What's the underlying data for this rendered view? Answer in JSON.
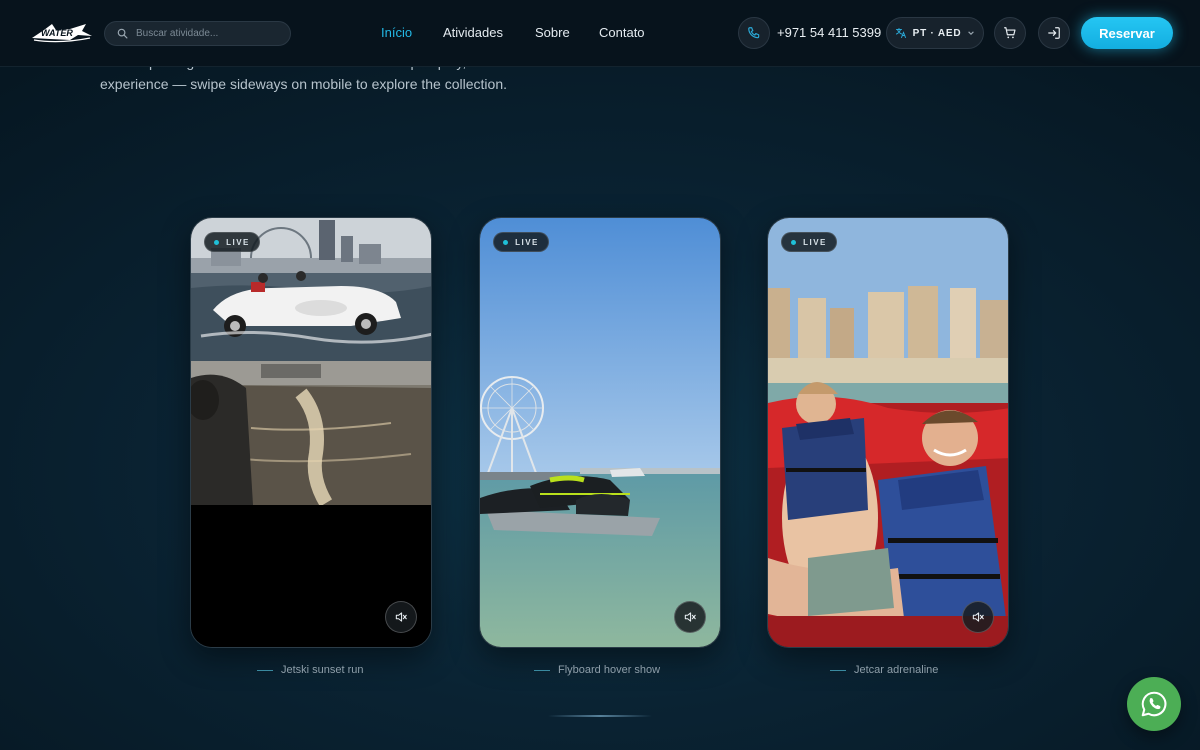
{
  "header": {
    "logo_text": "WATER",
    "search_placeholder": "Buscar atividade...",
    "nav": [
      "Início",
      "Atividades",
      "Sobre",
      "Contato"
    ],
    "active_nav": "Início",
    "phone": "+971 54 411 5399",
    "language": "PT · AED",
    "reserve_label": "Reservar"
  },
  "intro": {
    "text": "Each clip is a genuine moment from our fleet — tap to play, unmute for the full experience — swipe sideways on mobile to explore the collection."
  },
  "cards": [
    {
      "badge": "LIVE",
      "caption": "Jetski sunset run"
    },
    {
      "badge": "LIVE",
      "caption": "Flyboard hover show"
    },
    {
      "badge": "LIVE",
      "caption": "Jetcar adrenaline"
    }
  ],
  "colors": {
    "accent": "#23b9e6",
    "reserve": "#25c6f3",
    "whatsapp": "#4cae55",
    "background": "#0a2333"
  },
  "icons": {
    "search": "search-icon",
    "phone": "phone-icon",
    "currency": "translate-icon",
    "cart": "cart-icon",
    "login": "login-icon",
    "mute": "muted-speaker-icon",
    "whatsapp": "whatsapp-icon"
  }
}
